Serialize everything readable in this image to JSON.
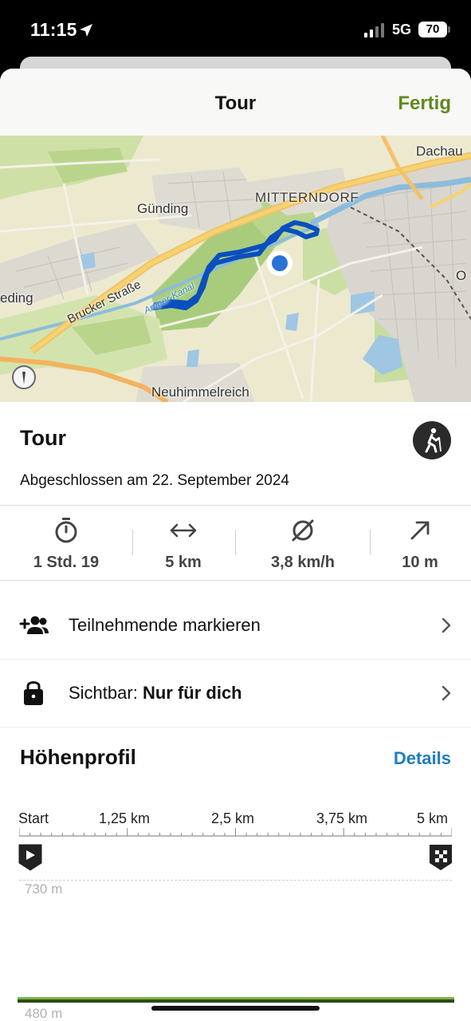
{
  "status_bar": {
    "time": "11:15",
    "network": "5G",
    "battery": "70"
  },
  "header": {
    "title": "Tour",
    "done_label": "Fertig"
  },
  "map": {
    "labels": {
      "dachau": "Dachau",
      "mitterndorf": "MITTERNDORF",
      "gunding": "Günding",
      "eding": "eding",
      "brucker": "Brucker Straße",
      "amper": "Amper-Kanal",
      "neuhimmelreich": "Neuhimmelreich",
      "ost": "O"
    }
  },
  "tour": {
    "title": "Tour",
    "completed": "Abgeschlossen am 22. September 2024",
    "activity_icon": "hiking-icon"
  },
  "stats": [
    {
      "icon": "stopwatch-icon",
      "value": "1 Std. 19"
    },
    {
      "icon": "distance-arrows-icon",
      "value": "5 km"
    },
    {
      "icon": "average-speed-icon",
      "value": "3,8 km/h"
    },
    {
      "icon": "ascent-arrow-icon",
      "value": "10 m"
    }
  ],
  "rows": {
    "participants": {
      "label": "Teilnehmende markieren"
    },
    "visibility": {
      "label": "Sichtbar:",
      "value": "Nur für dich"
    }
  },
  "elevation": {
    "title": "Höhenprofil",
    "details_label": "Details",
    "axis_ticks": [
      "Start",
      "1,25 km",
      "2,5 km",
      "3,75 km",
      "5 km"
    ],
    "max_label": "730 m",
    "min_label": "480 m"
  },
  "colors": {
    "accent_green": "#5e8a1e",
    "link_blue": "#1f7cc0",
    "route_blue": "#0a4fbf"
  }
}
